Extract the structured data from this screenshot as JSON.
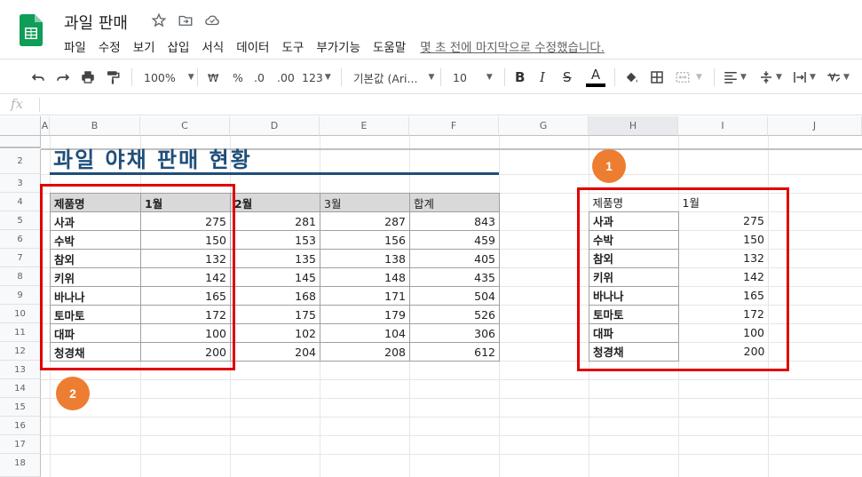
{
  "doc": {
    "title": "과일 판매"
  },
  "menu": {
    "items": [
      "파일",
      "수정",
      "보기",
      "삽입",
      "서식",
      "데이터",
      "도구",
      "부가기능",
      "도움말"
    ],
    "last_edit": "몇 초 전에 마지막으로 수정했습니다."
  },
  "toolbar": {
    "zoom": "100%",
    "currency": "₩",
    "percent": "%",
    "decrease_decimal": ".0",
    "increase_decimal": ".00",
    "format_more": "123",
    "font": "기본값 (Ari...",
    "font_size": "10",
    "bold": "B",
    "italic": "I",
    "strike": "S",
    "text_color": "A"
  },
  "formula": {
    "fx": "fx",
    "value": ""
  },
  "columns": [
    "A",
    "B",
    "C",
    "D",
    "E",
    "F",
    "G",
    "H",
    "I",
    "J"
  ],
  "rows": [
    "2",
    "3",
    "4",
    "5",
    "6",
    "7",
    "8",
    "9",
    "10",
    "11",
    "12",
    "13",
    "14",
    "15",
    "16",
    "17",
    "18"
  ],
  "sheet": {
    "title": "과일 야채 판매 현황",
    "headers": [
      "제품명",
      "1월",
      "2월",
      "3월",
      "합계"
    ],
    "products": [
      {
        "name": "사과",
        "m1": "275",
        "m2": "281",
        "m3": "287",
        "total": "843"
      },
      {
        "name": "수박",
        "m1": "150",
        "m2": "153",
        "m3": "156",
        "total": "459"
      },
      {
        "name": "참외",
        "m1": "132",
        "m2": "135",
        "m3": "138",
        "total": "405"
      },
      {
        "name": "키위",
        "m1": "142",
        "m2": "145",
        "m3": "148",
        "total": "435"
      },
      {
        "name": "바나나",
        "m1": "165",
        "m2": "168",
        "m3": "171",
        "total": "504"
      },
      {
        "name": "토마토",
        "m1": "172",
        "m2": "175",
        "m3": "179",
        "total": "526"
      },
      {
        "name": "대파",
        "m1": "100",
        "m2": "102",
        "m3": "104",
        "total": "306"
      },
      {
        "name": "청경채",
        "m1": "200",
        "m2": "204",
        "m3": "208",
        "total": "612"
      }
    ]
  },
  "annotations": {
    "badge1": "1",
    "badge2": "2",
    "badge_color": "#ED7D31",
    "box_color": "#E00000"
  },
  "colors": {
    "title_blue": "#1F4E79",
    "header_gray": "#D9D9D9",
    "sheets_green": "#0F9D58"
  }
}
